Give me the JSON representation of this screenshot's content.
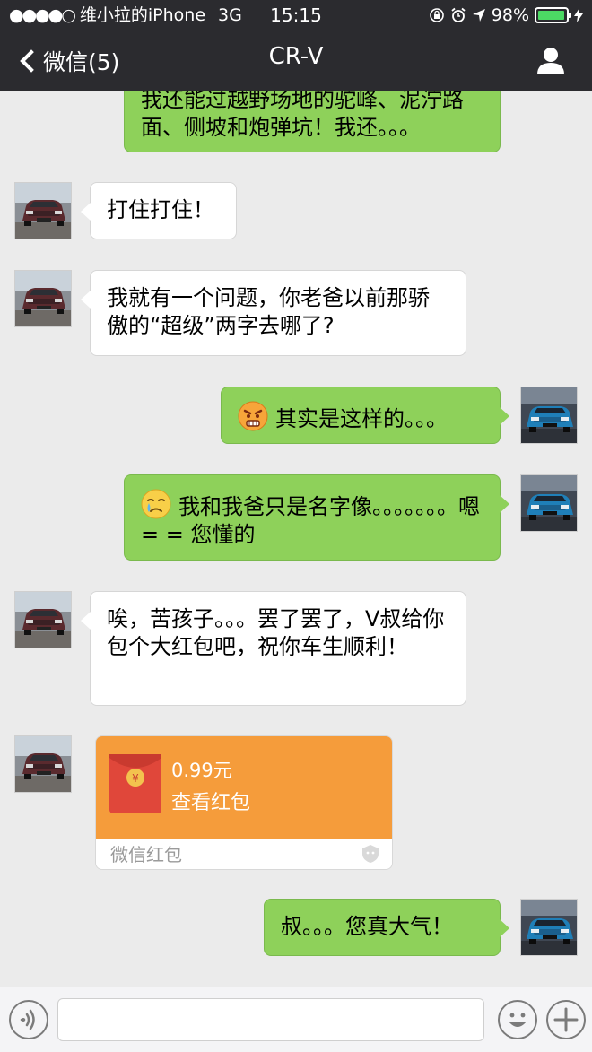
{
  "status_bar": {
    "signal": "●●●●○",
    "carrier": "维小拉的iPhone",
    "network": "3G",
    "time": "15:15",
    "battery": "98%",
    "battery_level": 0.98
  },
  "nav": {
    "back_label": "微信(5)",
    "title": "CR-V"
  },
  "messages": [
    {
      "id": "m0",
      "direction": "out",
      "text": "我还能过越野场地的驼峰、泥泞路面、侧坡和炮弹坑！我还。。。"
    },
    {
      "id": "m1",
      "direction": "in",
      "text": "打住打住！"
    },
    {
      "id": "m2",
      "direction": "in",
      "text": "我就有一个问题，你老爸以前那骄傲的“超级”两字去哪了?"
    },
    {
      "id": "m3",
      "direction": "out",
      "emoji": "angry-face-emoji",
      "text": "其实是这样的。。。"
    },
    {
      "id": "m4",
      "direction": "out",
      "emoji": "crying-face-emoji",
      "text": "我和我爸只是名字像。。。。。。。嗯= = 您懂的"
    },
    {
      "id": "m5",
      "direction": "in",
      "text": "唉，苦孩子。。。罢了罢了，V叔给你包个大红包吧，祝你车生顺利！"
    },
    {
      "id": "m7",
      "direction": "out",
      "text": "叔。。。您真大气！"
    }
  ],
  "red_packet": {
    "amount": "0.99元",
    "action": "查看红包",
    "footer": "微信红包"
  },
  "input_bar": {
    "placeholder": ""
  },
  "colors": {
    "header_bg": "#2b2b2f",
    "chat_bg": "#ebebeb",
    "outgoing_bubble": "#8ed15a",
    "incoming_bubble": "#ffffff",
    "red_packet": "#f59c3b"
  },
  "icons": {
    "back": "chevron-left-icon",
    "profile": "person-icon",
    "voice": "voice-icon",
    "emoji": "smiley-icon",
    "plus": "plus-icon"
  }
}
